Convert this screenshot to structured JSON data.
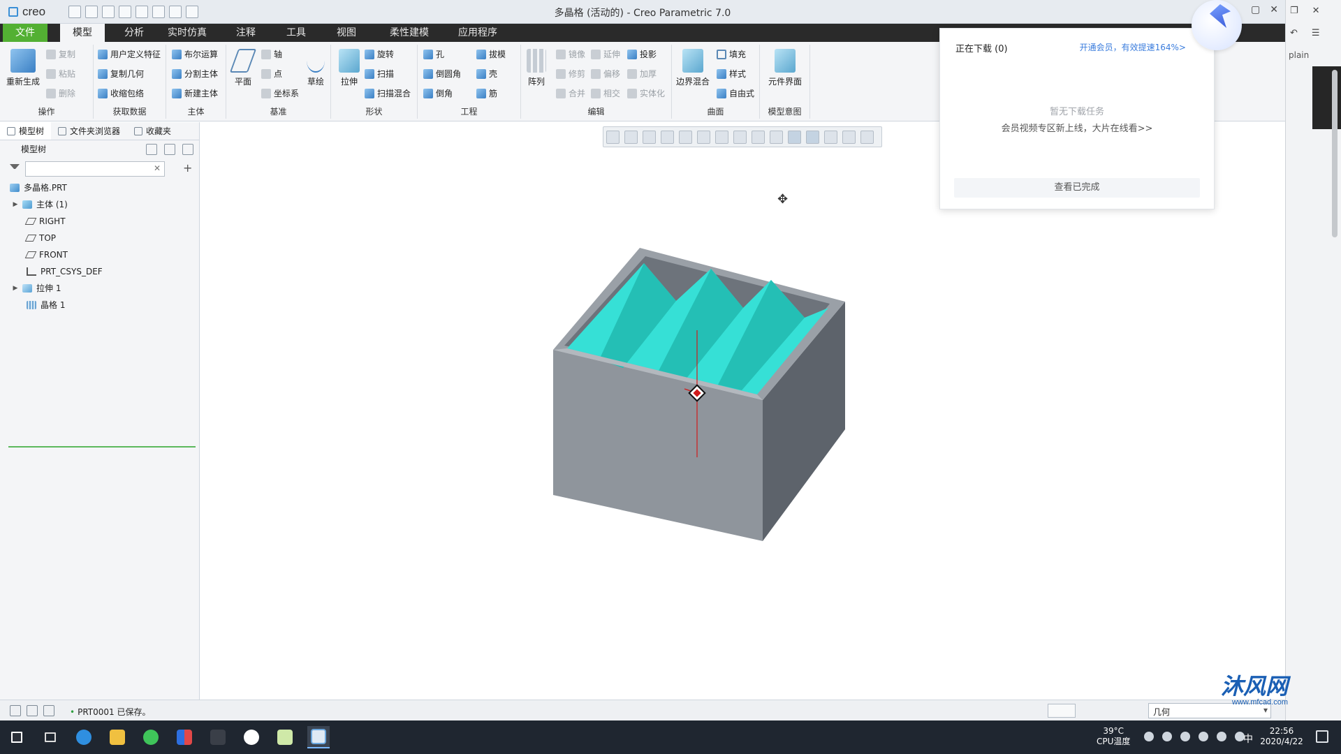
{
  "window": {
    "app_logo": "creo",
    "title": "多晶格 (活动的) - Creo Parametric 7.0"
  },
  "tabs": [
    "文件",
    "模型",
    "分析",
    "实时仿真",
    "注释",
    "工具",
    "视图",
    "柔性建模",
    "应用程序"
  ],
  "ribbon": {
    "ops": {
      "regen": "重新生成",
      "copy": "复制",
      "paste": "粘贴",
      "delete": "删除",
      "title": "操作"
    },
    "get_data": {
      "udf": "用户定义特征",
      "copy_geom": "复制几何",
      "shrinkwrap": "收缩包络",
      "title": "获取数据"
    },
    "body": {
      "boolean": "布尔运算",
      "split": "分割主体",
      "new_body": "新建主体",
      "title": "主体"
    },
    "datum": {
      "plane": "平面",
      "axis": "轴",
      "point": "点",
      "csys": "坐标系",
      "sketch": "草绘",
      "title": "基准"
    },
    "shapes": {
      "extrude": "拉伸",
      "revolve": "旋转",
      "sweep": "扫描",
      "swept_blend": "扫描混合",
      "title": "形状"
    },
    "engineering": {
      "hole": "孔",
      "draft": "拔模",
      "round": "倒圆角",
      "shell": "壳",
      "chamfer": "倒角",
      "rib": "筋",
      "title": "工程"
    },
    "editing": {
      "pattern": "阵列",
      "mirror": "镜像",
      "extend": "延伸",
      "project": "投影",
      "trim": "修剪",
      "offset": "偏移",
      "thicken": "加厚",
      "merge": "合并",
      "intersect": "相交",
      "solidify": "实体化",
      "title": "编辑"
    },
    "surfaces": {
      "boundary_blend": "边界混合",
      "fill": "填充",
      "style": "样式",
      "freestyle": "自由式",
      "title": "曲面"
    },
    "model_intent": {
      "component_interface": "元件界面",
      "title": "模型意图"
    }
  },
  "panel": {
    "tabs": [
      "模型树",
      "文件夹浏览器",
      "收藏夹"
    ],
    "tree_label": "模型树",
    "search_value": "",
    "tree": [
      {
        "label": "多晶格.PRT",
        "icon": "part-icon",
        "expander": ""
      },
      {
        "label": "主体 (1)",
        "icon": "body-icon",
        "expander": "▶"
      },
      {
        "label": "RIGHT",
        "icon": "datum-plane-icon",
        "expander": ""
      },
      {
        "label": "TOP",
        "icon": "datum-plane-icon",
        "expander": ""
      },
      {
        "label": "FRONT",
        "icon": "datum-plane-icon",
        "expander": ""
      },
      {
        "label": "PRT_CSYS_DEF",
        "icon": "csys-icon",
        "expander": ""
      },
      {
        "label": "拉伸 1",
        "icon": "extrude-icon",
        "expander": "▶"
      },
      {
        "label": "晶格 1",
        "icon": "lattice-icon",
        "expander": ""
      }
    ]
  },
  "download_popup": {
    "title": "正在下载 (0)",
    "vip_link": "开通会员，有效提速164%>",
    "empty_text": "暂无下载任务",
    "promo_text": "会员视频专区新上线，大片在线看>>",
    "done_button": "查看已完成"
  },
  "right_pane": {
    "partial_text": "plain"
  },
  "status": {
    "message": "PRT0001 已保存。",
    "filter_value": "几何"
  },
  "watermark": {
    "brand": "沐风网",
    "url": "www.mfcad.com"
  },
  "taskbar": {
    "cpu_temp": "39°C",
    "cpu_label": "CPU温度",
    "ime": "中",
    "time": "22:56",
    "date": "2020/4/22"
  },
  "colors": {
    "file_tab": "#53b033",
    "model_face": "#8f959c",
    "model_side": "#5d636b",
    "model_cavity": "#36e0d6",
    "accent_link": "#3b7ddd"
  }
}
